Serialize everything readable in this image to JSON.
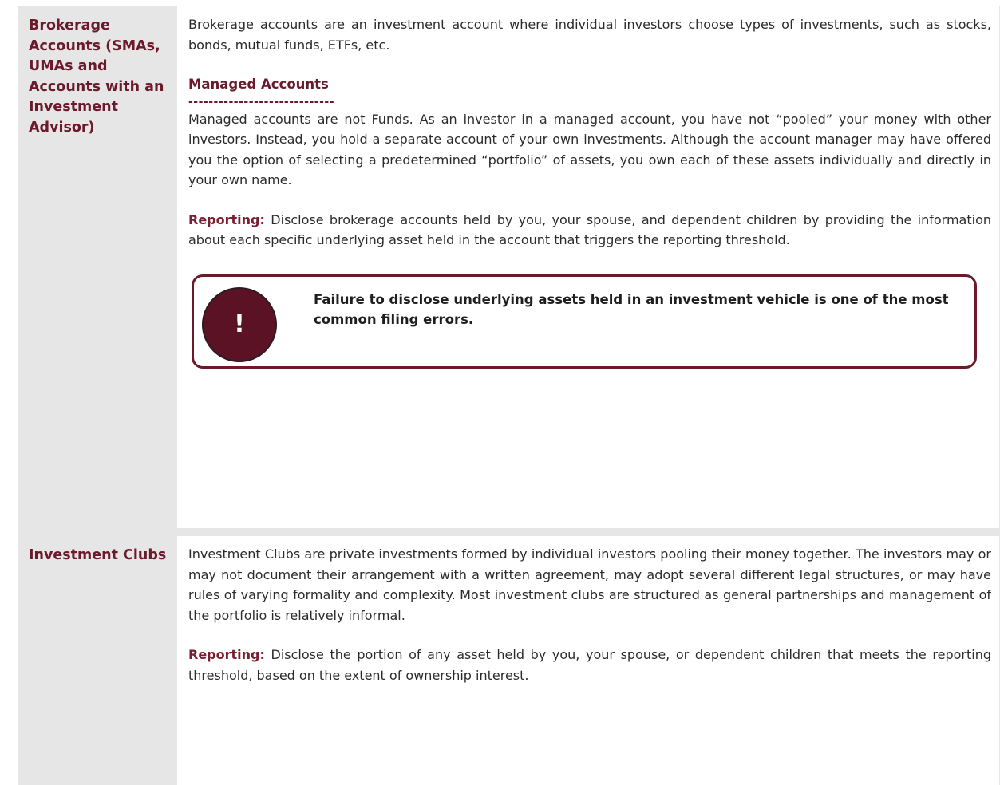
{
  "rows": [
    {
      "label": "Brokerage Accounts (SMAs, UMAs and Accounts with an Investment Advisor)",
      "intro": "Brokerage accounts are an investment account where individual investors choose types of investments, such as stocks, bonds, mutual funds, ETFs, etc.",
      "subheading": "Managed Accounts",
      "divider": "-----------------------------",
      "managed_text": "Managed accounts are not Funds. As an investor in a managed account, you have not “pooled” your money with other investors. Instead, you hold a separate account of your own investments. Although the account manager may have offered you the option of selecting a predetermined “portfolio” of assets, you own each of these assets individually and directly in your own name.",
      "reporting_label": "Reporting:",
      "reporting_text": "Disclose brokerage accounts held by you, your spouse, and dependent children by providing the information about each specific underlying asset held in the account that triggers the reporting threshold.",
      "callout": {
        "icon_glyph": "!",
        "text": "Failure to disclose underlying assets held in an investment vehicle is one of the most common filing errors."
      }
    },
    {
      "label": "Investment Clubs",
      "intro": "Investment Clubs are private investments formed by individual investors pooling their money together. The investors may or may not document their arrangement with a written agreement, may adopt several different legal structures, or may have rules of varying formality and complexity. Most investment clubs are structured as general partnerships and management of the portfolio is relatively informal.",
      "reporting_label": "Reporting:",
      "reporting_text": "Disclose the portion of any asset held by you, your spouse, or dependent children that meets the reporting threshold, based on the extent of ownership interest."
    }
  ],
  "colors": {
    "accent": "#6b1a2b",
    "label_bg": "#e6e6e6",
    "callout_circle": "#5a1224"
  }
}
